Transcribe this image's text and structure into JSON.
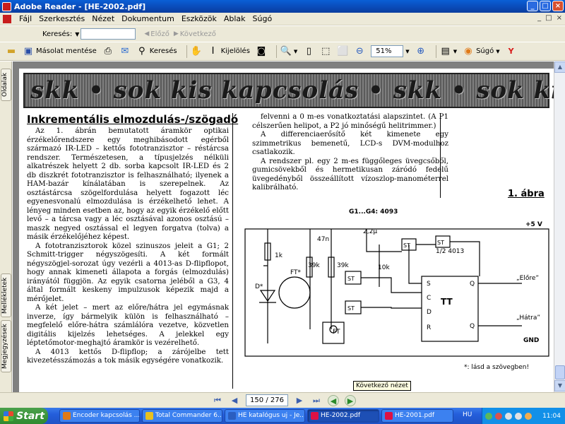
{
  "window": {
    "title": "Adobe Reader - [HE-2002.pdf]",
    "controls": [
      "_",
      "□",
      "×"
    ]
  },
  "menu": {
    "items": [
      "Fájl",
      "Szerkesztés",
      "Nézet",
      "Dokumentum",
      "Eszközök",
      "Ablak",
      "Súgó"
    ],
    "mdi_controls": [
      "_",
      "□",
      "×"
    ]
  },
  "search": {
    "label": "Keresés:",
    "value": "",
    "prev": "Előző",
    "next": "Következő"
  },
  "toolbar": {
    "save_copy": "Másolat mentése",
    "search": "Keresés",
    "select": "Kijelölés",
    "zoom_value": "51%",
    "help": "Súgó"
  },
  "side_tabs": {
    "pages": "Oldalak",
    "attachments": "Mellékletek",
    "comments": "Megjegyzések"
  },
  "document": {
    "banner": "skk • sok kis kapcsolás • skk • sok kis kapcsolás",
    "heading": "Inkrementális elmozdulás-/szögadó",
    "col1": [
      "Az 1. ábrán bemutatott áramkör optikai érzékelőrendszere egy meghibásodott egérből származó IR-LED – kettős fototranzisztor – réstárcsa rendszer. Természetesen, a típusjelzés nélküli alkatrészek helyett 2 db. sorba kapcsolt IR-LED és 2 db diszkrét fototranzisztor is felhasználható; ilyenek a HAM-bazár kínálatában is szerepelnek. Az osztástárcsa szögelfordulása helyett fogazott léc egyenesvonalú elmozdulása is érzékelhető lehet. A lényeg minden esetben az, hogy az egyik érzékelő előtt levő – a tárcsa vagy a léc osztásával azonos osztású – maszk negyed osztással el legyen forgatva (tolva) a másik érzékelőjéhez képest.",
      "A fototranzisztorok közel szinuszos jeleit a G1; 2 Schmitt-trigger négyszögesíti. A két formált négyszögjel-sorozat úgy vezérli a 4013-as D-flipflopot, hogy annak kimeneti állapota a forgás (elmozdulás) irányától függjön. Az egyik csatorna jeléből a G3, 4 által formált keskeny impulzusok képezik majd a mérőjelet.",
      "A két jelet – mert az előre/hátra jel egymásnak inverze, így bármelyik külön is felhasználható – megfelelő előre-hátra számlálóra vezetve, közvetlen digitális kijelzés lehetséges. A jelekkel egy léptetőmotor-meghajtó áramkör is vezérelhető.",
      "A 4013 kettős D-flipflop; a zárójelbe tett kivezetésszámozás a tok másik egységére vonatkozik."
    ],
    "col2": [
      "felvenni a 0 m-es vonatkoztatási alapszintet. (A P1 célszerűen helipot, a P2 jó minőségű helitrimmer.)",
      "A differenciaerősítő két kimenete egy szimmetrikus bemenetű, LCD-s DVM-modulhoz csatlakozik.",
      "A rendszer pl. egy 2 m-es függőleges üvegcsőből, gumicsövekből és hermetikusan záródó fedelű üvegedényből összeállított vízoszlop-manométerrel kalibrálható."
    ],
    "figure_label": "1. ábra",
    "schematic": {
      "chips": "G1...G4: 4093",
      "ic": "1/2 4013",
      "ff": "TT",
      "supply": "+5 V",
      "gnd": "GND",
      "out_fwd": "„Előre”",
      "out_back": "„Hátra”",
      "note": "*: lásd a szövegben!",
      "parts": [
        "47n",
        "2,2μ",
        "1k",
        "39k",
        "39k",
        "10k",
        "FT*",
        "D*",
        "FT"
      ]
    }
  },
  "tooltip": "Következő nézet",
  "pager": {
    "value": "150 / 276"
  },
  "taskbar": {
    "start": "Start",
    "tasks": [
      "Encoder kapcsolás ...",
      "Total Commander 6....",
      "HE katalógus uj - Je...",
      "HE-2002.pdf",
      "HE-2001.pdf"
    ],
    "lang": "HU",
    "clock": "11:04"
  }
}
